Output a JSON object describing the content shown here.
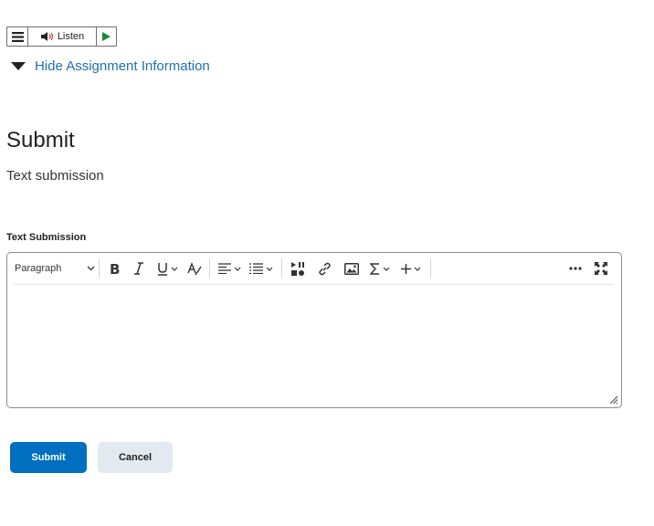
{
  "readspeaker": {
    "listen_label": "Listen"
  },
  "assignment_info": {
    "toggle_label": "Hide Assignment Information"
  },
  "submit_section": {
    "heading": "Submit",
    "description": "Text submission",
    "field_label": "Text Submission"
  },
  "editor": {
    "block_format": "Paragraph",
    "content": ""
  },
  "actions": {
    "submit_label": "Submit",
    "cancel_label": "Cancel"
  },
  "colors": {
    "link": "#1f6eb5",
    "primary": "#006fbf",
    "secondary_bg": "#e3e9f1",
    "play_green": "#1b8a3a"
  }
}
